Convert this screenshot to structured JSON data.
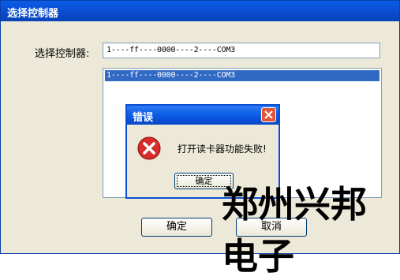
{
  "window": {
    "title": "选择控制器"
  },
  "form": {
    "label": "选择控制器:",
    "combo_value": "1----ff----0000----2----COM3"
  },
  "list": {
    "items": [
      "1----ff----0000----2----COM3"
    ]
  },
  "buttons": {
    "ok": "确定",
    "cancel": "取消"
  },
  "error_dialog": {
    "title": "错误",
    "message": "打开读卡器功能失败!",
    "ok": "确定"
  },
  "watermark": "郑州兴邦电子",
  "colors": {
    "titlebar": "#0a5ce6",
    "selection": "#316ac5",
    "close": "#e0553a",
    "error": "#d92b2b"
  },
  "icons": {
    "close": "close-icon",
    "error": "error-icon"
  }
}
